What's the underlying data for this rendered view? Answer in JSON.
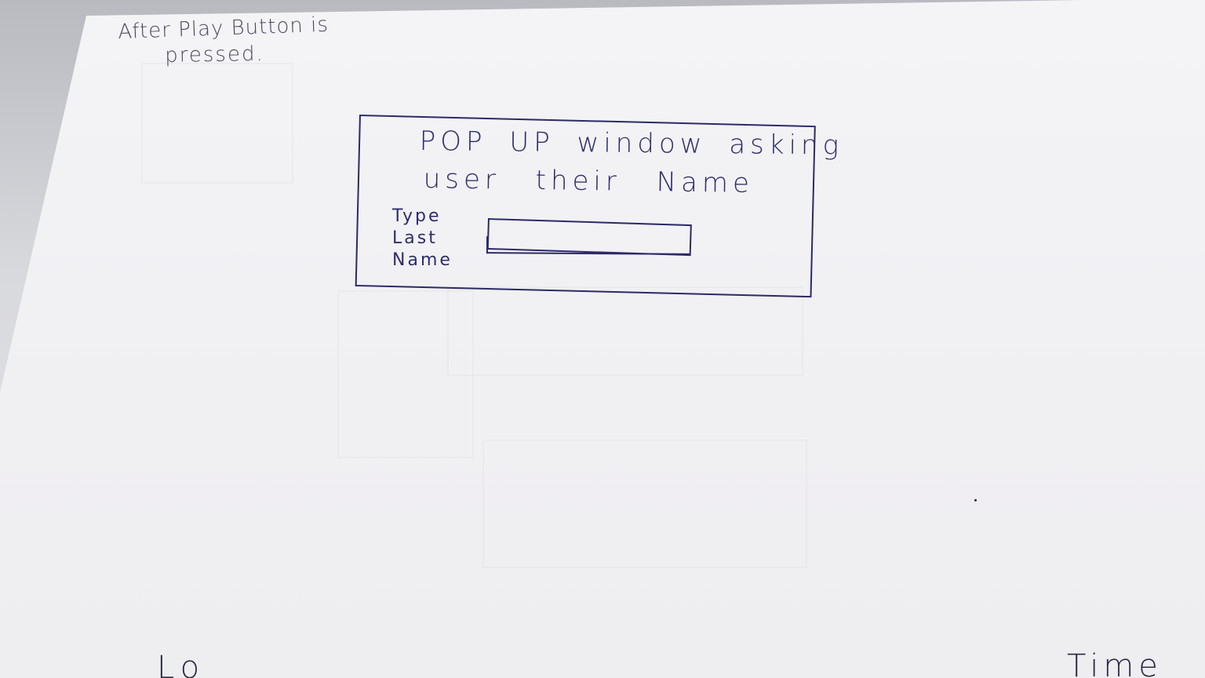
{
  "sketch": {
    "note_line1": "After Play Button is",
    "note_line2": "pressed.",
    "popup": {
      "title_line1": "POP UP window asking",
      "title_line2": "user their Name",
      "field_label": "Type\nLast\nName",
      "field_value": ""
    },
    "bottom_left_text": "Lo",
    "bottom_right_text": "Time"
  },
  "colors": {
    "ink": "#2f2d6b",
    "paper": "#f2f1f4",
    "pencil": "#4b4a5e"
  }
}
